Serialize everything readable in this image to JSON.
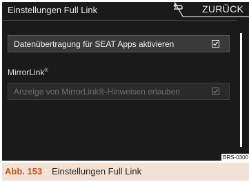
{
  "screen": {
    "title": "Einstellungen Full Link",
    "back_label": "ZURÜCK",
    "back_icon": "return-arrow-icon",
    "settings": [
      {
        "label": "Datenübertragung für SEAT Apps aktivieren",
        "checked": true,
        "enabled": true
      }
    ],
    "section_title": "MirrorLink",
    "section_title_mark": "®",
    "section_settings": [
      {
        "label": "Anzeige von MirrorLink®-Hinweisen erlauben",
        "checked": true,
        "enabled": false
      }
    ],
    "reference_code": "BRS-0300"
  },
  "caption": {
    "number": "Abb. 153",
    "text": "Einstellungen Full Link"
  },
  "colors": {
    "screen_bg": "#1a1a1a",
    "caption_bg": "#f2e2d6",
    "caption_accent": "#c2511f"
  }
}
